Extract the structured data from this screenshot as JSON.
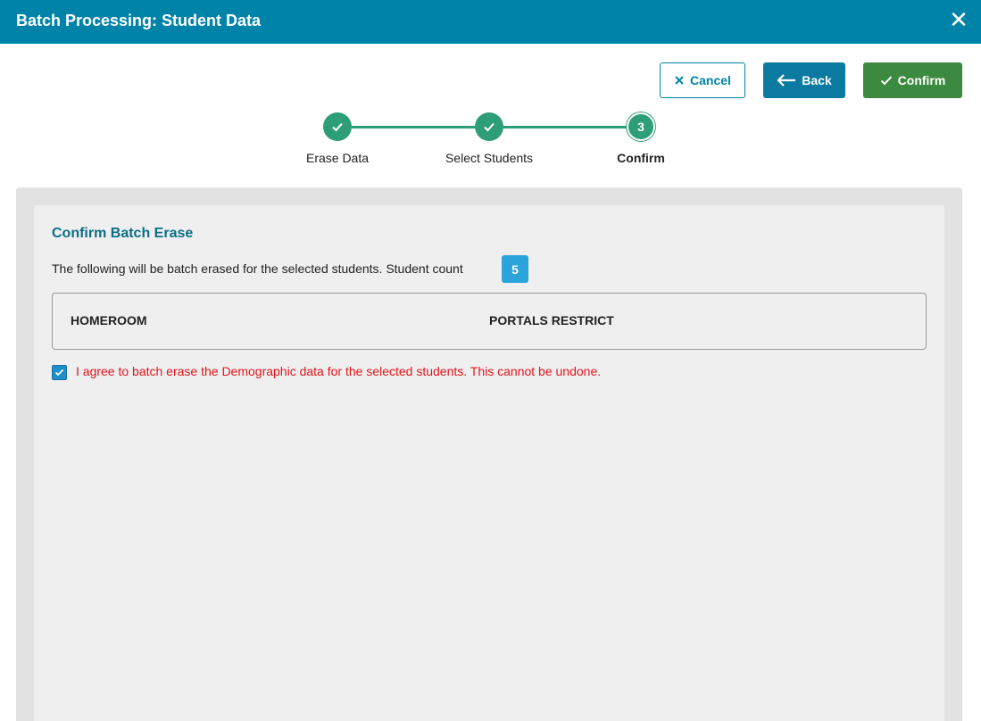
{
  "window": {
    "title": "Batch Processing: Student Data",
    "close_icon": "close-icon"
  },
  "toolbar": {
    "cancel_label": "Cancel",
    "back_label": "Back",
    "confirm_label": "Confirm"
  },
  "stepper": {
    "steps": [
      {
        "label": "Erase Data",
        "state": "complete"
      },
      {
        "label": "Select Students",
        "state": "complete"
      },
      {
        "label": "Confirm",
        "state": "current",
        "number": "3"
      }
    ],
    "color": "#2e9e78"
  },
  "content": {
    "heading": "Confirm Batch Erase",
    "description": "The following will be batch erased for the selected students. Student count",
    "student_count": "5",
    "fields": [
      "HOMEROOM",
      "PORTALS RESTRICT"
    ],
    "agree_checked": true,
    "agree_text": "I agree to batch erase the Demographic data for the selected students. This cannot be undone."
  },
  "colors": {
    "header": "#0083a9",
    "confirm_button": "#3c8a3f",
    "badge": "#2aa4db",
    "warning_text": "#e4141b"
  }
}
